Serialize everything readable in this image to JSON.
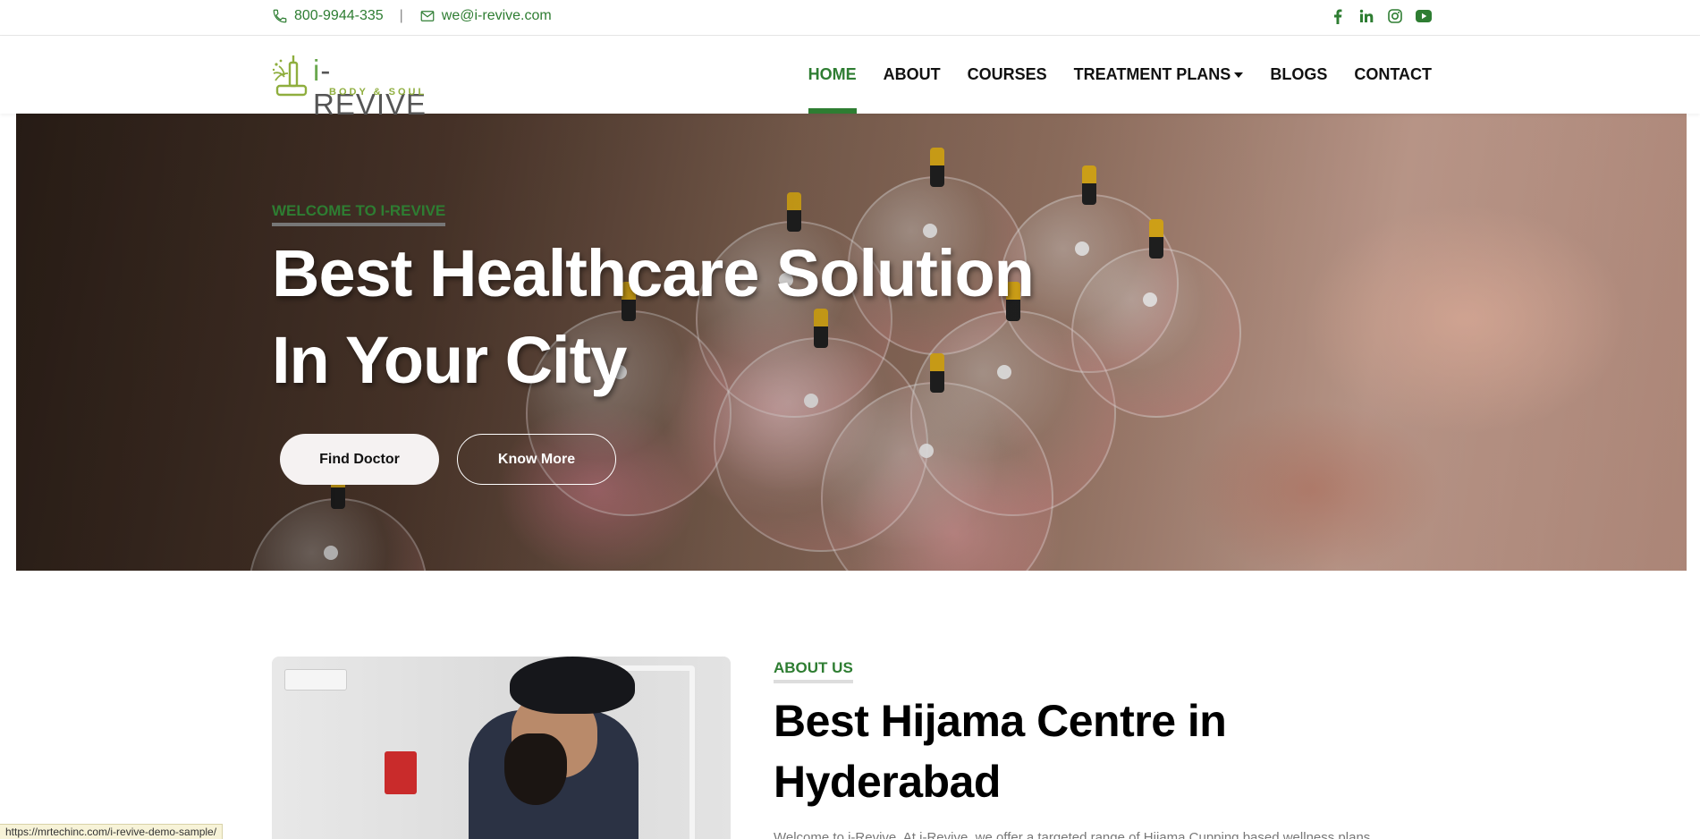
{
  "topbar": {
    "phone": "800-9944-335",
    "separator": "|",
    "email": "we@i-revive.com",
    "social": [
      {
        "name": "facebook-icon",
        "glyph": "f"
      },
      {
        "name": "linkedin-icon",
        "glyph": "in"
      },
      {
        "name": "instagram-icon",
        "glyph": "◎"
      },
      {
        "name": "youtube-icon",
        "glyph": "▶"
      }
    ]
  },
  "header": {
    "logo": {
      "name_i": "i",
      "name_rest": "-REVIVE",
      "tagline": "BODY & SOUL"
    },
    "nav": [
      {
        "label": "HOME",
        "active": true
      },
      {
        "label": "ABOUT",
        "active": false
      },
      {
        "label": "COURSES",
        "active": false
      },
      {
        "label": "TREATMENT PLANS",
        "active": false,
        "dropdown": true
      },
      {
        "label": "BLOGS",
        "active": false
      },
      {
        "label": "CONTACT",
        "active": false
      }
    ]
  },
  "hero": {
    "kicker": "WELCOME TO I-REVIVE",
    "title_line1": "Best Healthcare Solution",
    "title_line2": "In Your City",
    "primary_button": "Find Doctor",
    "secondary_button": "Know More"
  },
  "about": {
    "kicker": "ABOUT US",
    "title_line1": "Best Hijama Centre in",
    "title_line2": "Hyderabad",
    "paragraph": "Welcome to i-Revive. At i-Revive, we offer a targeted range of Hijama Cupping based wellness plans"
  },
  "statusbar": {
    "url": "https://mrtechinc.com/i-revive-demo-sample/"
  },
  "colors": {
    "accent": "#2e7d32",
    "logo_green": "#8fae3e"
  }
}
